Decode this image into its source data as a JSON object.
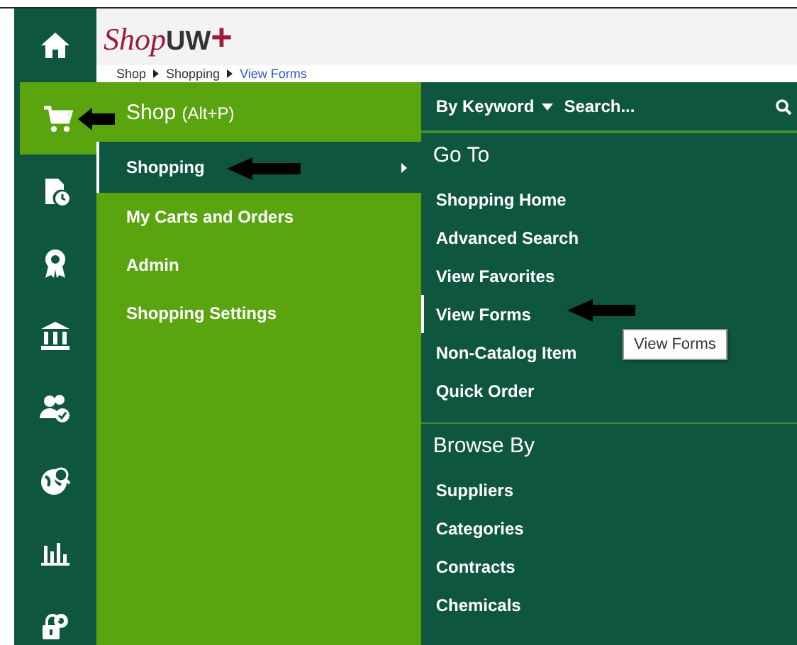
{
  "sidebar": {
    "items": [
      {
        "selected": false
      },
      {
        "selected": true
      },
      {
        "selected": false
      },
      {
        "selected": false
      },
      {
        "selected": false
      },
      {
        "selected": false
      },
      {
        "selected": false
      },
      {
        "selected": false
      },
      {
        "selected": false
      }
    ]
  },
  "header": {
    "logo": {
      "script": "Shop",
      "mark": "UW",
      "plus": "+"
    }
  },
  "breadcrumb": [
    {
      "label": "Shop",
      "link": false
    },
    {
      "label": "Shopping",
      "link": false
    },
    {
      "label": "View Forms",
      "link": true
    }
  ],
  "menu": {
    "title": "Shop",
    "shortcut": "(Alt+P)",
    "items": [
      {
        "label": "Shopping",
        "selected": true,
        "has_submenu": true
      },
      {
        "label": "My Carts and Orders",
        "selected": false,
        "has_submenu": false
      },
      {
        "label": "Admin",
        "selected": false,
        "has_submenu": false
      },
      {
        "label": "Shopping Settings",
        "selected": false,
        "has_submenu": false
      }
    ]
  },
  "submenu": {
    "search": {
      "scope": "By Keyword",
      "placeholder": "Search..."
    },
    "sections": [
      {
        "title": "Go To",
        "items": [
          {
            "label": "Shopping Home",
            "selected": false
          },
          {
            "label": "Advanced Search",
            "selected": false
          },
          {
            "label": "View Favorites",
            "selected": false
          },
          {
            "label": "View Forms",
            "selected": true
          },
          {
            "label": "Non-Catalog Item",
            "selected": false
          },
          {
            "label": "Quick Order",
            "selected": false
          }
        ]
      },
      {
        "title": "Browse By",
        "items": [
          {
            "label": "Suppliers",
            "selected": false
          },
          {
            "label": "Categories",
            "selected": false
          },
          {
            "label": "Contracts",
            "selected": false
          },
          {
            "label": "Chemicals",
            "selected": false
          }
        ]
      }
    ]
  },
  "tooltip": "View Forms"
}
